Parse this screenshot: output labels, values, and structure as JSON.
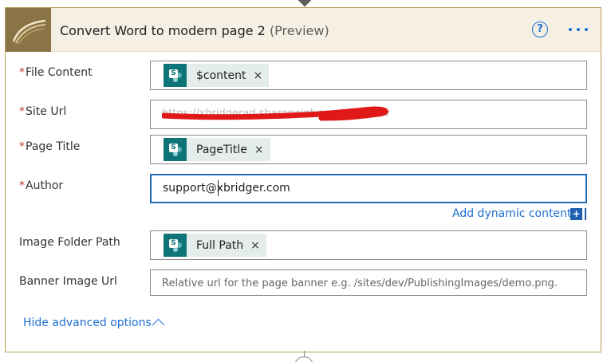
{
  "card": {
    "title": "Convert Word to modern page 2",
    "preview": "(Preview)",
    "help_icon": "question-circle-icon",
    "more_icon": "ellipsis-icon",
    "accent_color": "#1e6fd0",
    "header_bg": "#f5efe4",
    "border_color": "#b89c5a"
  },
  "fields": {
    "file_content": {
      "required_mark": "*",
      "label": "File Content",
      "token": "$content",
      "remove": "×"
    },
    "site_url": {
      "required_mark": "*",
      "label": "Site Url",
      "value_redacted": "https://xbridgerad.sharepoint.com/sites/dev"
    },
    "page_title": {
      "required_mark": "*",
      "label": "Page Title",
      "token": "PageTitle",
      "remove": "×"
    },
    "author": {
      "required_mark": "*",
      "label": "Author",
      "value": "support@xbridger.com"
    },
    "image_folder_path": {
      "label": "Image Folder Path",
      "token": "Full Path",
      "remove": "×"
    },
    "banner_image_url": {
      "label": "Banner Image Url",
      "placeholder": "Relative url for the page banner e.g. /sites/dev/PublishingImages/demo.png."
    }
  },
  "dynamic": {
    "label": "Add dynamic content",
    "plus": "+"
  },
  "advanced": {
    "label": "Hide advanced options"
  },
  "token_icon": "sharepoint-icon",
  "token_icon_letter": "S"
}
